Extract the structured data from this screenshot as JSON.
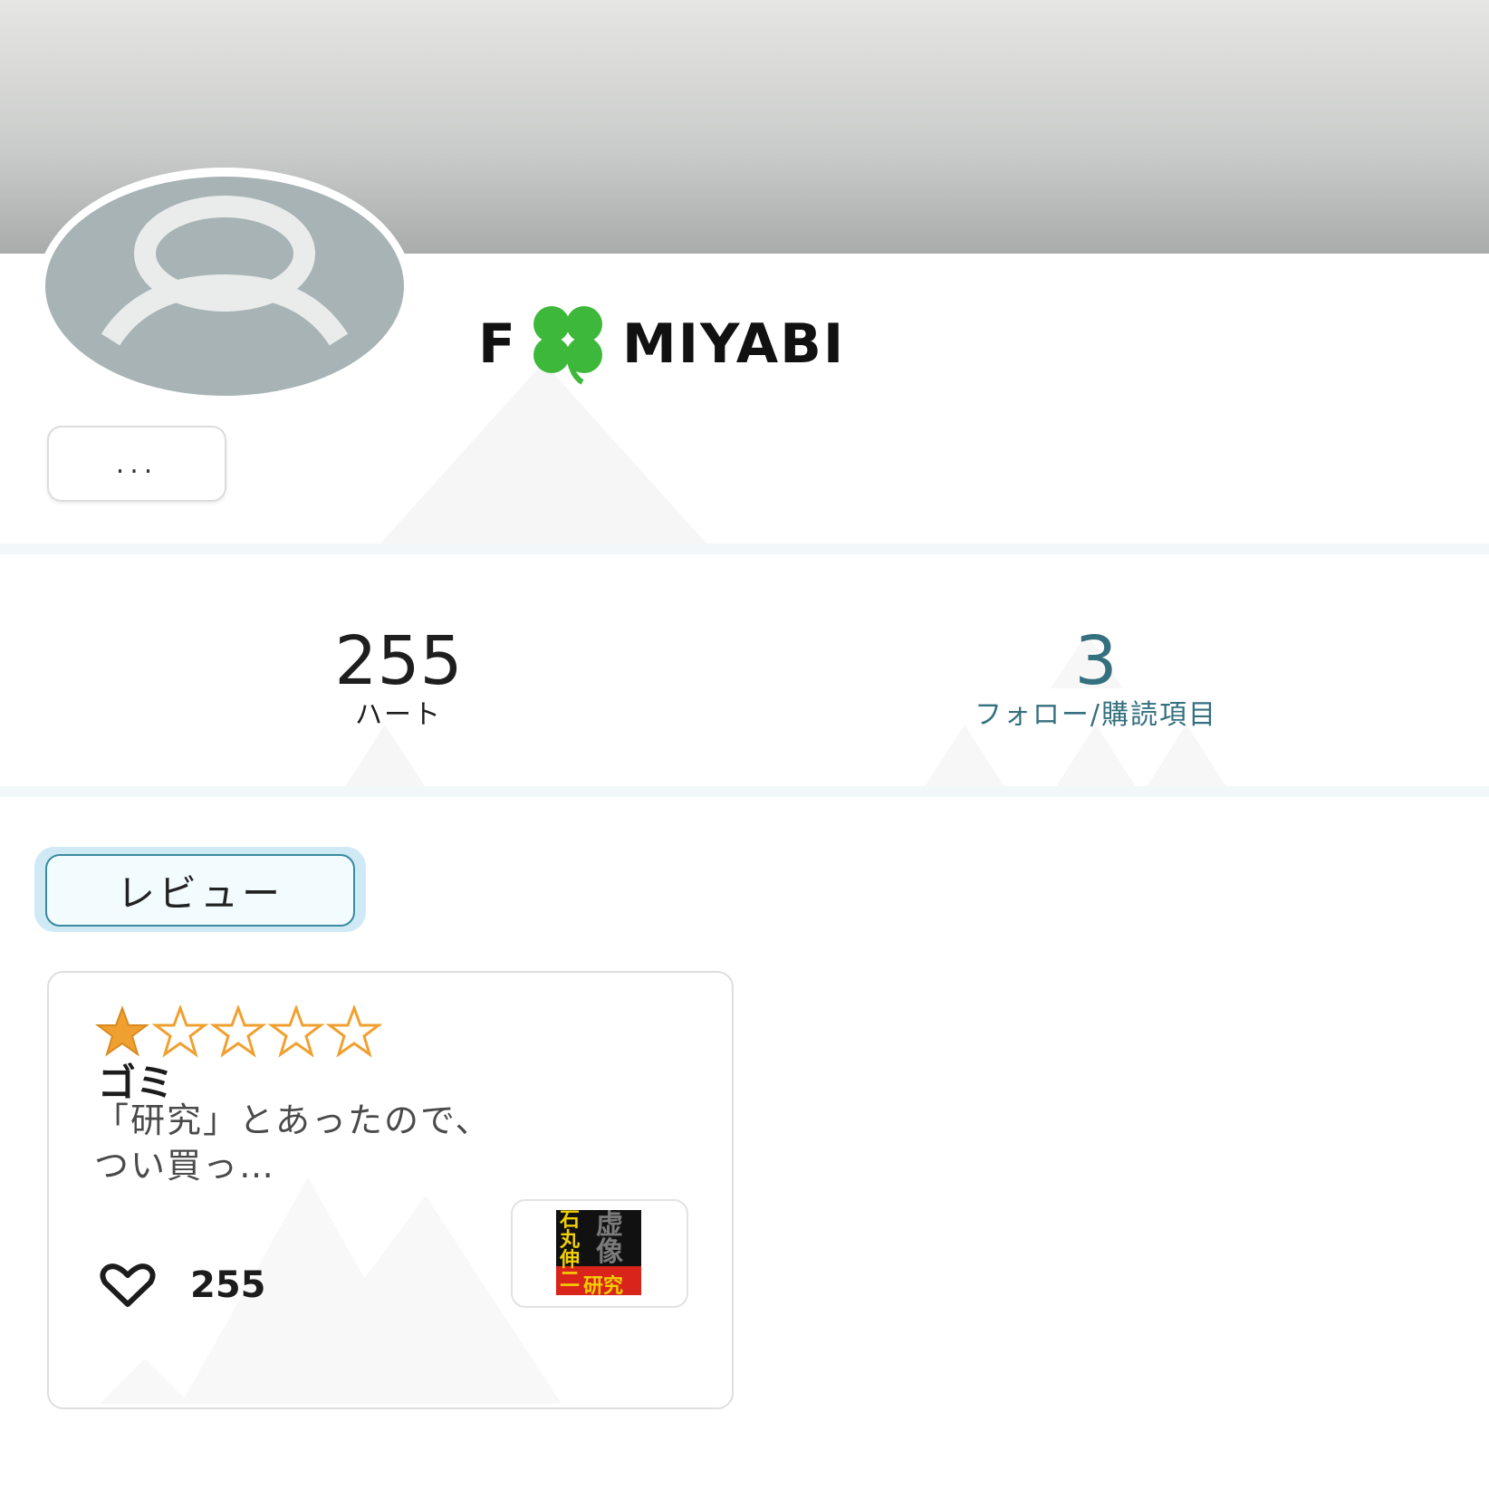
{
  "header": {
    "brand_left": "F",
    "brand_right": "MIYABI",
    "more_label": "..."
  },
  "stats": {
    "hearts": {
      "value": "255",
      "label": "ハート"
    },
    "follow": {
      "value": "3",
      "label": "フォロー/購読項目"
    }
  },
  "tabs": [
    {
      "label": "レビュー",
      "active": true
    }
  ],
  "review": {
    "rating": 1,
    "rating_max": 5,
    "title": "ゴミ",
    "body": "「研究」とあったので、つい買っ…",
    "likes": "255",
    "book_cover_text": {
      "vertical_title": "石丸伸二",
      "main": "虚像",
      "sub": "研究"
    }
  },
  "colors": {
    "accent_teal": "#35707f",
    "star_fill": "#f0a030",
    "avatar_bg": "#a8b3b6",
    "clover": "#3db83a"
  }
}
